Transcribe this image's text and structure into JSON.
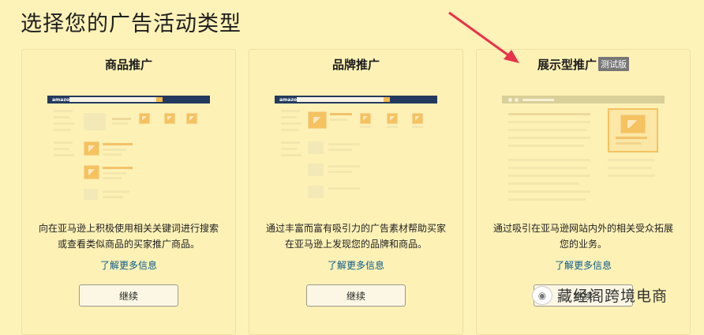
{
  "page": {
    "title": "选择您的广告活动类型"
  },
  "cards": [
    {
      "title": "商品推广",
      "description": "向在亚马逊上积极使用相关关键词进行搜索或查看类似商品的买家推广商品。",
      "learn_more": "了解更多信息",
      "button": "继续",
      "nav_logo": "amazon"
    },
    {
      "title": "品牌推广",
      "description": "通过丰富而富有吸引力的广告素材帮助买家在亚马逊上发现您的品牌和商品。",
      "learn_more": "了解更多信息",
      "button": "继续",
      "nav_logo": "amazon"
    },
    {
      "title": "展示型推广",
      "badge": "测试版",
      "description": "通过吸引在亚马逊网站内外的相关受众拓展您的业务。",
      "learn_more": "了解更多信息",
      "button": "继续"
    }
  ],
  "watermark": {
    "text": "藏经阁跨境电商",
    "icon": "wechat-icon"
  },
  "colors": {
    "background": "#fdf2b8",
    "nav_bar": "#233a5e",
    "accent_orange": "#f4c260",
    "link": "#0b5c8a",
    "arrow": "#e8334a"
  }
}
